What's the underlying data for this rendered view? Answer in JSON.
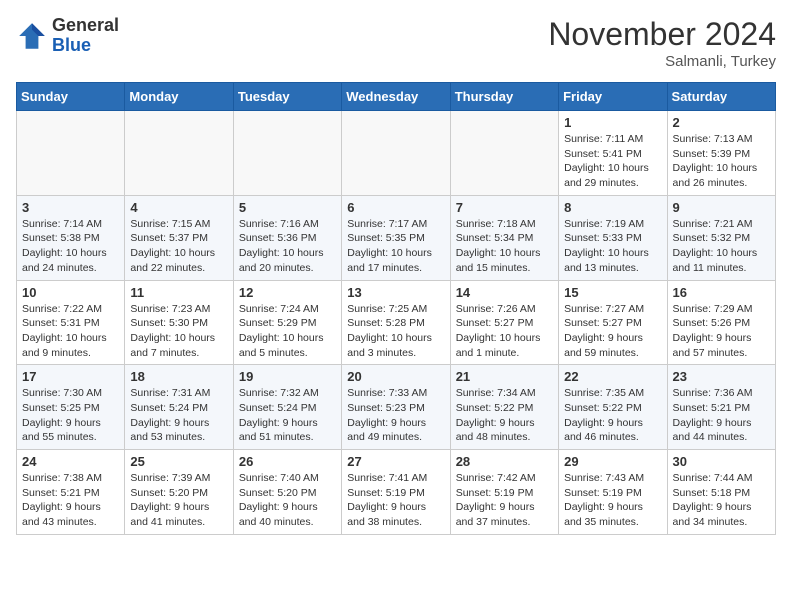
{
  "header": {
    "month_title": "November 2024",
    "location": "Salmanli, Turkey",
    "logo_general": "General",
    "logo_blue": "Blue"
  },
  "days_of_week": [
    "Sunday",
    "Monday",
    "Tuesday",
    "Wednesday",
    "Thursday",
    "Friday",
    "Saturday"
  ],
  "weeks": [
    [
      {
        "day": "",
        "info": ""
      },
      {
        "day": "",
        "info": ""
      },
      {
        "day": "",
        "info": ""
      },
      {
        "day": "",
        "info": ""
      },
      {
        "day": "",
        "info": ""
      },
      {
        "day": "1",
        "info": "Sunrise: 7:11 AM\nSunset: 5:41 PM\nDaylight: 10 hours and 29 minutes."
      },
      {
        "day": "2",
        "info": "Sunrise: 7:13 AM\nSunset: 5:39 PM\nDaylight: 10 hours and 26 minutes."
      }
    ],
    [
      {
        "day": "3",
        "info": "Sunrise: 7:14 AM\nSunset: 5:38 PM\nDaylight: 10 hours and 24 minutes."
      },
      {
        "day": "4",
        "info": "Sunrise: 7:15 AM\nSunset: 5:37 PM\nDaylight: 10 hours and 22 minutes."
      },
      {
        "day": "5",
        "info": "Sunrise: 7:16 AM\nSunset: 5:36 PM\nDaylight: 10 hours and 20 minutes."
      },
      {
        "day": "6",
        "info": "Sunrise: 7:17 AM\nSunset: 5:35 PM\nDaylight: 10 hours and 17 minutes."
      },
      {
        "day": "7",
        "info": "Sunrise: 7:18 AM\nSunset: 5:34 PM\nDaylight: 10 hours and 15 minutes."
      },
      {
        "day": "8",
        "info": "Sunrise: 7:19 AM\nSunset: 5:33 PM\nDaylight: 10 hours and 13 minutes."
      },
      {
        "day": "9",
        "info": "Sunrise: 7:21 AM\nSunset: 5:32 PM\nDaylight: 10 hours and 11 minutes."
      }
    ],
    [
      {
        "day": "10",
        "info": "Sunrise: 7:22 AM\nSunset: 5:31 PM\nDaylight: 10 hours and 9 minutes."
      },
      {
        "day": "11",
        "info": "Sunrise: 7:23 AM\nSunset: 5:30 PM\nDaylight: 10 hours and 7 minutes."
      },
      {
        "day": "12",
        "info": "Sunrise: 7:24 AM\nSunset: 5:29 PM\nDaylight: 10 hours and 5 minutes."
      },
      {
        "day": "13",
        "info": "Sunrise: 7:25 AM\nSunset: 5:28 PM\nDaylight: 10 hours and 3 minutes."
      },
      {
        "day": "14",
        "info": "Sunrise: 7:26 AM\nSunset: 5:27 PM\nDaylight: 10 hours and 1 minute."
      },
      {
        "day": "15",
        "info": "Sunrise: 7:27 AM\nSunset: 5:27 PM\nDaylight: 9 hours and 59 minutes."
      },
      {
        "day": "16",
        "info": "Sunrise: 7:29 AM\nSunset: 5:26 PM\nDaylight: 9 hours and 57 minutes."
      }
    ],
    [
      {
        "day": "17",
        "info": "Sunrise: 7:30 AM\nSunset: 5:25 PM\nDaylight: 9 hours and 55 minutes."
      },
      {
        "day": "18",
        "info": "Sunrise: 7:31 AM\nSunset: 5:24 PM\nDaylight: 9 hours and 53 minutes."
      },
      {
        "day": "19",
        "info": "Sunrise: 7:32 AM\nSunset: 5:24 PM\nDaylight: 9 hours and 51 minutes."
      },
      {
        "day": "20",
        "info": "Sunrise: 7:33 AM\nSunset: 5:23 PM\nDaylight: 9 hours and 49 minutes."
      },
      {
        "day": "21",
        "info": "Sunrise: 7:34 AM\nSunset: 5:22 PM\nDaylight: 9 hours and 48 minutes."
      },
      {
        "day": "22",
        "info": "Sunrise: 7:35 AM\nSunset: 5:22 PM\nDaylight: 9 hours and 46 minutes."
      },
      {
        "day": "23",
        "info": "Sunrise: 7:36 AM\nSunset: 5:21 PM\nDaylight: 9 hours and 44 minutes."
      }
    ],
    [
      {
        "day": "24",
        "info": "Sunrise: 7:38 AM\nSunset: 5:21 PM\nDaylight: 9 hours and 43 minutes."
      },
      {
        "day": "25",
        "info": "Sunrise: 7:39 AM\nSunset: 5:20 PM\nDaylight: 9 hours and 41 minutes."
      },
      {
        "day": "26",
        "info": "Sunrise: 7:40 AM\nSunset: 5:20 PM\nDaylight: 9 hours and 40 minutes."
      },
      {
        "day": "27",
        "info": "Sunrise: 7:41 AM\nSunset: 5:19 PM\nDaylight: 9 hours and 38 minutes."
      },
      {
        "day": "28",
        "info": "Sunrise: 7:42 AM\nSunset: 5:19 PM\nDaylight: 9 hours and 37 minutes."
      },
      {
        "day": "29",
        "info": "Sunrise: 7:43 AM\nSunset: 5:19 PM\nDaylight: 9 hours and 35 minutes."
      },
      {
        "day": "30",
        "info": "Sunrise: 7:44 AM\nSunset: 5:18 PM\nDaylight: 9 hours and 34 minutes."
      }
    ]
  ]
}
